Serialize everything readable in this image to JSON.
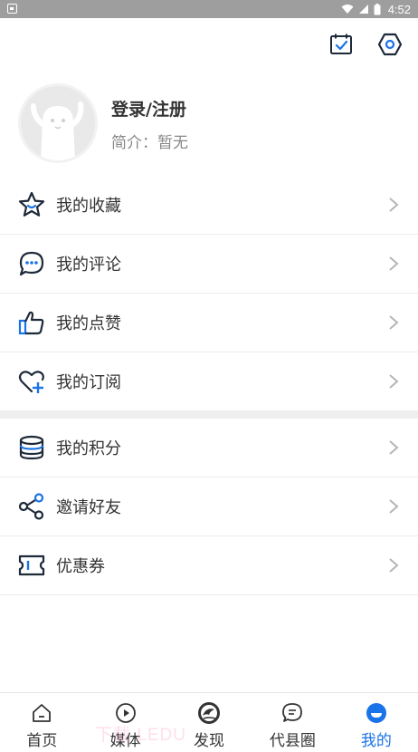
{
  "status_bar": {
    "time": "4:52"
  },
  "profile": {
    "name": "登录/注册",
    "bio": "简介：暂无"
  },
  "menu_group_1": [
    {
      "label": "我的收藏",
      "icon": "star-icon"
    },
    {
      "label": "我的评论",
      "icon": "comment-icon"
    },
    {
      "label": "我的点赞",
      "icon": "thumbs-up-icon"
    },
    {
      "label": "我的订阅",
      "icon": "heart-plus-icon"
    }
  ],
  "menu_group_2": [
    {
      "label": "我的积分",
      "icon": "coin-stack-icon"
    },
    {
      "label": "邀请好友",
      "icon": "share-icon"
    },
    {
      "label": "优惠券",
      "icon": "ticket-icon"
    }
  ],
  "tabs": [
    {
      "label": "首页",
      "icon": "home-icon",
      "active": false
    },
    {
      "label": "媒体",
      "icon": "play-icon",
      "active": false
    },
    {
      "label": "发现",
      "icon": "discover-icon",
      "active": false
    },
    {
      "label": "代县圈",
      "icon": "chat-bubble-icon",
      "active": false
    },
    {
      "label": "我的",
      "icon": "profile-icon",
      "active": true
    }
  ],
  "watermark": "下载 LEDU",
  "colors": {
    "accent": "#1a73e8",
    "icon_dark": "#1e2a3a",
    "divider": "#efefef"
  }
}
